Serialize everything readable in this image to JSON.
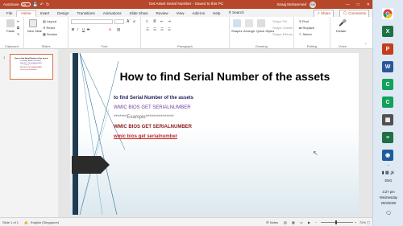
{
  "titlebar": {
    "autosave_label": "AutoSave",
    "autosave_state": "Off",
    "doc_title": "Get Asset Serial Number  -  Saved to this PC",
    "user_name": "Siraaj Mohammed",
    "avatar_initials": "SM",
    "minimize": "—",
    "maximize": "□",
    "close": "✕"
  },
  "tabs": [
    "File",
    "Home",
    "Insert",
    "Design",
    "Transitions",
    "Animations",
    "Slide Show",
    "Review",
    "View",
    "Add-ins",
    "Help"
  ],
  "active_tab": "Home",
  "search_label": "Search",
  "share_label": "Share",
  "comments_label": "Comments",
  "ribbon": {
    "groups": {
      "clipboard": "Clipboard",
      "slides": "Slides",
      "font": "Font",
      "paragraph": "Paragraph",
      "drawing": "Drawing",
      "editing": "Editing",
      "voice": "Voice"
    },
    "paste": "Paste",
    "new_slide": "New Slide",
    "layout": "Layout",
    "reset": "Reset",
    "section": "Section",
    "shapes": "Shapes",
    "arrange": "Arrange",
    "quick_styles": "Quick Styles",
    "shape_fill": "Shape Fill",
    "shape_outline": "Shape Outline",
    "shape_effects": "Shape Effects",
    "find": "Find",
    "replace": "Replace",
    "select": "Select",
    "dictate": "Dictate",
    "bold": "B",
    "italic": "I",
    "underline": "U",
    "strike": "S"
  },
  "thumbnail": {
    "number": "1",
    "title": "How to find Serial Number of the assets",
    "lines": [
      "to find Serial Number of the assets",
      "WMIC BIOS GET SERIALNUMBER",
      "*******Example***************",
      "WMIC BIOS GET SERIALNUMBER",
      "wmic bios get serialnumber"
    ]
  },
  "slide": {
    "title": "How to find Serial Number of the assets",
    "lines": [
      "to find Serial Number of the assets",
      "WMIC BIOS GET SERIALNUMBER",
      "*******Example***************",
      "WMIC BIOS GET SERIALNUMBER",
      "wmic bios get serialnumber"
    ]
  },
  "status": {
    "slide_info": "Slide 1 of 1",
    "language": "English (Singapore)",
    "notes": "Notes",
    "zoom": "72%"
  },
  "taskbar": {
    "apps": [
      {
        "name": "chrome",
        "label": "",
        "color": "#ffffff"
      },
      {
        "name": "excel",
        "label": "X",
        "color": "#1e7145"
      },
      {
        "name": "powerpoint",
        "label": "P",
        "color": "#c43e1c"
      },
      {
        "name": "word",
        "label": "W",
        "color": "#2b579a"
      },
      {
        "name": "green-app-1",
        "label": "C",
        "color": "#12a15a"
      },
      {
        "name": "green-app-2",
        "label": "C",
        "color": "#12a15a"
      },
      {
        "name": "calculator",
        "label": "▦",
        "color": "#505050"
      },
      {
        "name": "notes-app",
        "label": "≡",
        "color": "#1e7145"
      },
      {
        "name": "blue-app",
        "label": "◉",
        "color": "#1e5b9c"
      }
    ],
    "lang": "ENG",
    "time": "3:27 pm",
    "day": "Wednesday",
    "date": "29/4/2020"
  }
}
